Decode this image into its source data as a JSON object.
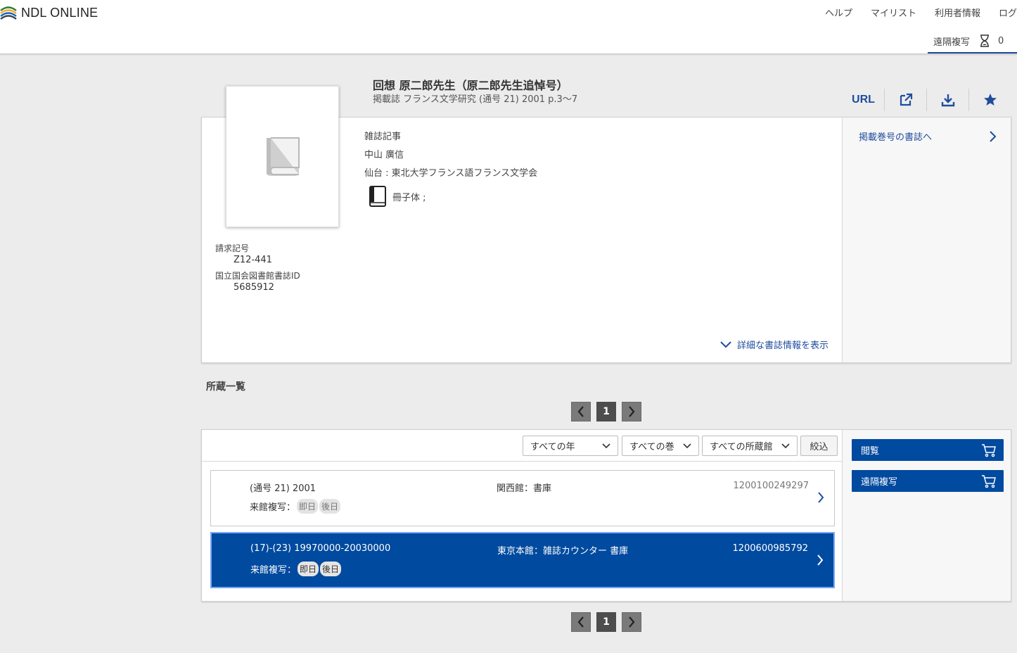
{
  "header": {
    "logo_text": "NDL ONLINE",
    "nav": [
      "ヘルプ",
      "マイリスト",
      "利用者情報",
      "ログ"
    ],
    "remote_copy_label": "遠隔複写",
    "remote_copy_count": "0"
  },
  "item": {
    "title": "回想 原二郎先生（原二郎先生追悼号）",
    "subtitle": "掲載誌 フランス文学研究 (通号 21) 2001 p.3〜7",
    "type": "雑誌記事",
    "author": "中山 廣信",
    "publisher": "仙台 : 東北大学フランス語フランス文学会",
    "form": "冊子体 ;",
    "call_number_label": "請求記号",
    "call_number": "Z12-441",
    "ndl_id_label": "国立国会図書館書誌ID",
    "ndl_id": "5685912",
    "detail_link": "詳細な書誌情報を表示",
    "volume_link": "掲載巻号の書誌へ"
  },
  "actions": {
    "url_label": "URL",
    "icons": [
      "external-link-icon",
      "download-icon",
      "star-icon"
    ]
  },
  "holdings": {
    "title": "所蔵一覧",
    "pager_current": "1",
    "filters": {
      "year": "すべての年",
      "volume": "すべての巻",
      "library": "すべての所蔵館",
      "apply": "絞込"
    },
    "copy_label": "来館複写：",
    "tag_same_day": "即日",
    "tag_later": "後日",
    "rows": [
      {
        "volume": "(通号 21) 2001",
        "location": "関西館：書庫",
        "barcode": "1200100249297"
      },
      {
        "volume": "(17)-(23) 19970000-20030000",
        "location": "東京本館：雑誌カウンター 書庫",
        "barcode": "1200600985792"
      }
    ],
    "buttons": {
      "view": "閲覧",
      "remote_copy": "遠隔複写"
    }
  },
  "colors": {
    "brand_blue": "#004a9f",
    "link_blue": "#1f4c9e"
  }
}
